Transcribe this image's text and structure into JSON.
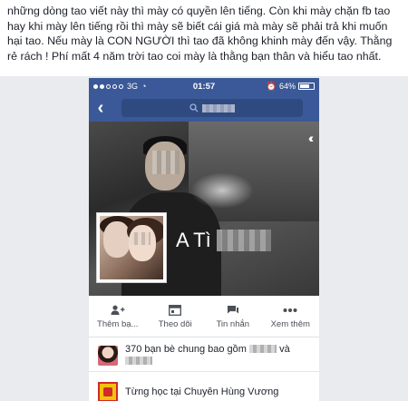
{
  "post": {
    "text": "những dòng tao viết này thì mày có quyền lên tiếng. Còn khi mày chặn fb tao hay khi mày lên tiếng rồi thì mày sẽ biết cái giá mà mày sẽ phải trả khi muốn hại tao. Nếu mày là CON NGƯỜI thì tao đã không khinh mày đến vậy. Thằng rẻ rách ! Phí mất 4 năm trời tao coi mày là thằng bạn thân và hiểu tao nhất."
  },
  "status_bar": {
    "network": "3G",
    "time": "01:57",
    "battery": "64%",
    "signal_dots": 5,
    "signal_filled": 2
  },
  "nav": {
    "back_icon": "chevron-left-icon",
    "search_icon": "search-icon"
  },
  "profile": {
    "name_visible": "A  Tì"
  },
  "actions": [
    {
      "label": "Thêm bạ...",
      "icon": "add-friend-icon"
    },
    {
      "label": "Theo dõi",
      "icon": "follow-icon"
    },
    {
      "label": "Tin nhắn",
      "icon": "message-icon"
    },
    {
      "label": "Xem thêm",
      "icon": "more-icon"
    }
  ],
  "info": {
    "mutual_friends_prefix": "370 bạn bè chung bao gồm",
    "mutual_friends_join": "và",
    "education": "Từng học tại Chuyên Hùng Vương"
  },
  "colors": {
    "facebook_blue": "#3b5998",
    "background_grey": "#e9ebee"
  }
}
